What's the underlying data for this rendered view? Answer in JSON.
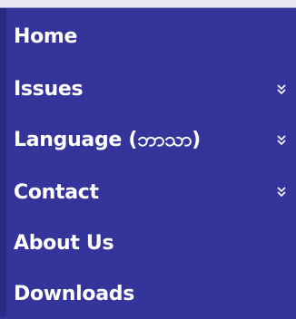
{
  "menu": {
    "items": [
      {
        "label": "Home",
        "has_submenu": false
      },
      {
        "label": "Issues",
        "has_submenu": true
      },
      {
        "label": "Language (ဘာသာ)",
        "has_submenu": true
      },
      {
        "label": "Contact",
        "has_submenu": true
      },
      {
        "label": "About Us",
        "has_submenu": false
      },
      {
        "label": "Downloads",
        "has_submenu": false
      }
    ]
  },
  "colors": {
    "menu_background": "#34349a",
    "text": "#ffffff",
    "top_strip": "#e8e8f4",
    "chevron": "#ffffff"
  },
  "icons": {
    "submenu": "double-chevron-down-icon"
  }
}
